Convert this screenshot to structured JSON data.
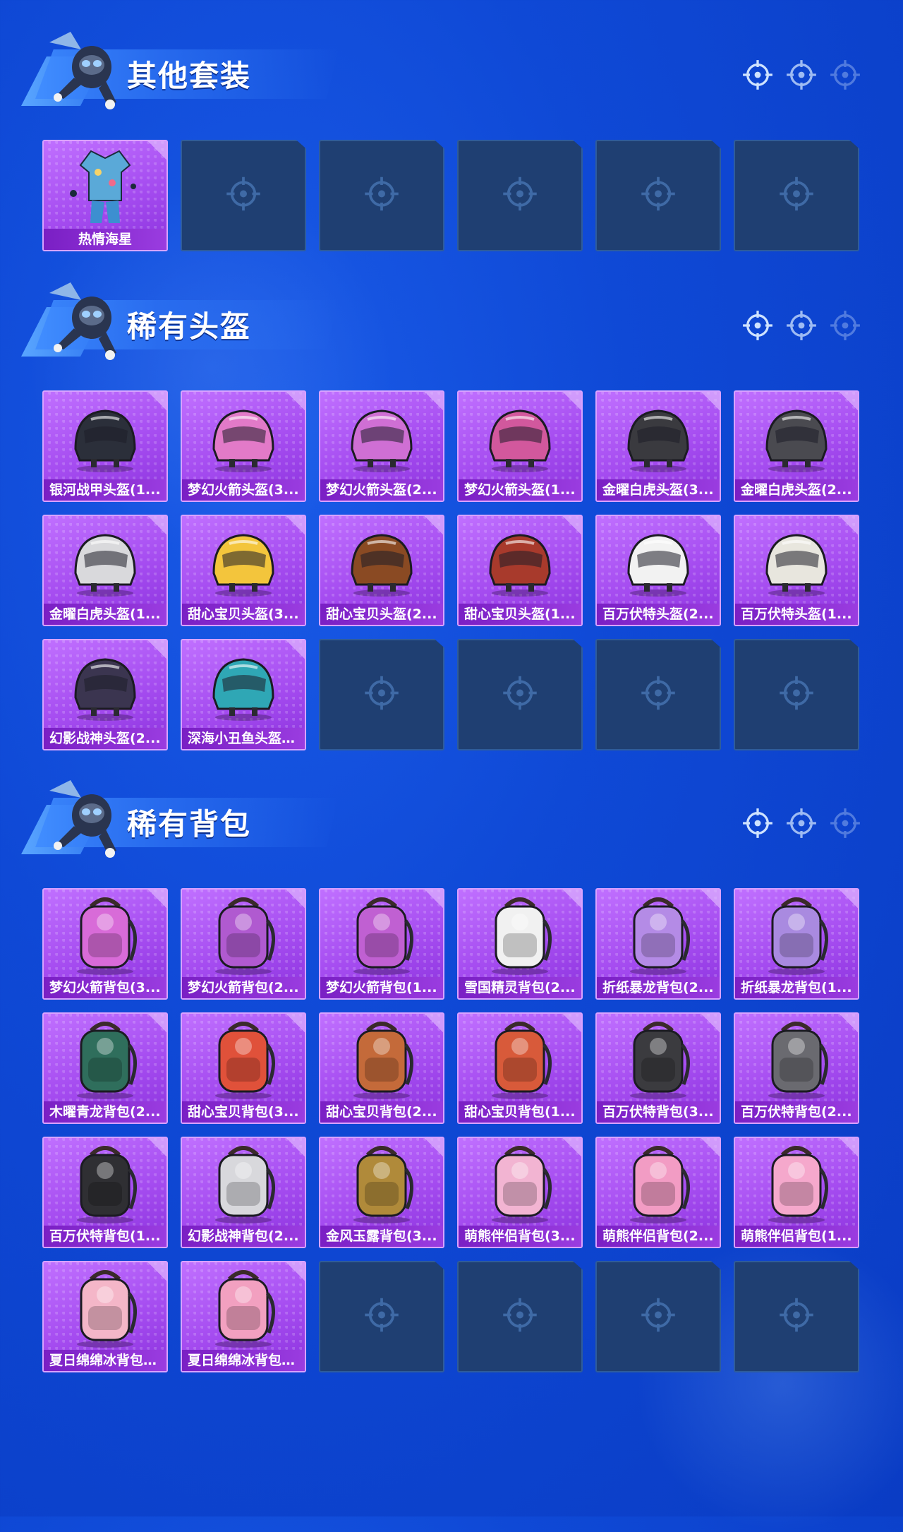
{
  "sections": [
    {
      "title": "其他套装",
      "items": [
        {
          "label": "热情海星",
          "kind": "outfit",
          "color": "#5aa9d8"
        },
        null,
        null,
        null,
        null,
        null
      ]
    },
    {
      "title": "稀有头盔",
      "items": [
        {
          "label": "银河战甲头盔(1...",
          "kind": "helmet",
          "color": "#2b2f3a"
        },
        {
          "label": "梦幻火箭头盔(3...",
          "kind": "helmet",
          "color": "#e27ac8"
        },
        {
          "label": "梦幻火箭头盔(2...",
          "kind": "helmet",
          "color": "#cf6fd4"
        },
        {
          "label": "梦幻火箭头盔(1...",
          "kind": "helmet",
          "color": "#d2589d"
        },
        {
          "label": "金曜白虎头盔(3...",
          "kind": "helmet",
          "color": "#3a3a3f"
        },
        {
          "label": "金曜白虎头盔(2...",
          "kind": "helmet",
          "color": "#4a4a50"
        },
        {
          "label": "金曜白虎头盔(1...",
          "kind": "helmet",
          "color": "#d9d9dc"
        },
        {
          "label": "甜心宝贝头盔(3...",
          "kind": "helmet",
          "color": "#f3c53c"
        },
        {
          "label": "甜心宝贝头盔(2...",
          "kind": "helmet",
          "color": "#8a4a23"
        },
        {
          "label": "甜心宝贝头盔(1...",
          "kind": "helmet",
          "color": "#a83a2c"
        },
        {
          "label": "百万伏特头盔(2...",
          "kind": "helmet",
          "color": "#f2f2f2"
        },
        {
          "label": "百万伏特头盔(1...",
          "kind": "helmet",
          "color": "#e8e6de"
        },
        {
          "label": "幻影战神头盔(2...",
          "kind": "helmet",
          "color": "#3b3550"
        },
        {
          "label": "深海小丑鱼头盔(...",
          "kind": "helmet",
          "color": "#2fa7b5"
        },
        null,
        null,
        null,
        null
      ]
    },
    {
      "title": "稀有背包",
      "items": [
        {
          "label": "梦幻火箭背包(3...",
          "kind": "backpack",
          "color": "#d86bd8"
        },
        {
          "label": "梦幻火箭背包(2...",
          "kind": "backpack",
          "color": "#b05ad0"
        },
        {
          "label": "梦幻火箭背包(1...",
          "kind": "backpack",
          "color": "#c060d2"
        },
        {
          "label": "雪国精灵背包(2...",
          "kind": "backpack",
          "color": "#f1f1f1"
        },
        {
          "label": "折纸暴龙背包(2...",
          "kind": "backpack",
          "color": "#b48be6"
        },
        {
          "label": "折纸暴龙背包(1...",
          "kind": "backpack",
          "color": "#a98ae0"
        },
        {
          "label": "木曜青龙背包(2...",
          "kind": "backpack",
          "color": "#2f6e5c"
        },
        {
          "label": "甜心宝贝背包(3...",
          "kind": "backpack",
          "color": "#e0513a"
        },
        {
          "label": "甜心宝贝背包(2...",
          "kind": "backpack",
          "color": "#c46a3a"
        },
        {
          "label": "甜心宝贝背包(1...",
          "kind": "backpack",
          "color": "#d85a3a"
        },
        {
          "label": "百万伏特背包(3...",
          "kind": "backpack",
          "color": "#3b3b3f"
        },
        {
          "label": "百万伏特背包(2...",
          "kind": "backpack",
          "color": "#6a6a70"
        },
        {
          "label": "百万伏特背包(1...",
          "kind": "backpack",
          "color": "#2f2f33"
        },
        {
          "label": "幻影战神背包(2...",
          "kind": "backpack",
          "color": "#d8d8dc"
        },
        {
          "label": "金风玉露背包(3...",
          "kind": "backpack",
          "color": "#b08a3a"
        },
        {
          "label": "萌熊伴侣背包(3...",
          "kind": "backpack",
          "color": "#f2b4d2"
        },
        {
          "label": "萌熊伴侣背包(2...",
          "kind": "backpack",
          "color": "#f29cc4"
        },
        {
          "label": "萌熊伴侣背包(1...",
          "kind": "backpack",
          "color": "#f5a8cc"
        },
        {
          "label": "夏日绵绵冰背包(...",
          "kind": "backpack",
          "color": "#f4b6c8"
        },
        {
          "label": "夏日绵绵冰背包(...",
          "kind": "backpack",
          "color": "#f2a0c0"
        },
        null,
        null,
        null,
        null
      ]
    }
  ],
  "icons": {
    "header": "parachute-mascot-icon",
    "reticle": "crosshair-icon",
    "empty_slot": "crosshair-icon"
  }
}
